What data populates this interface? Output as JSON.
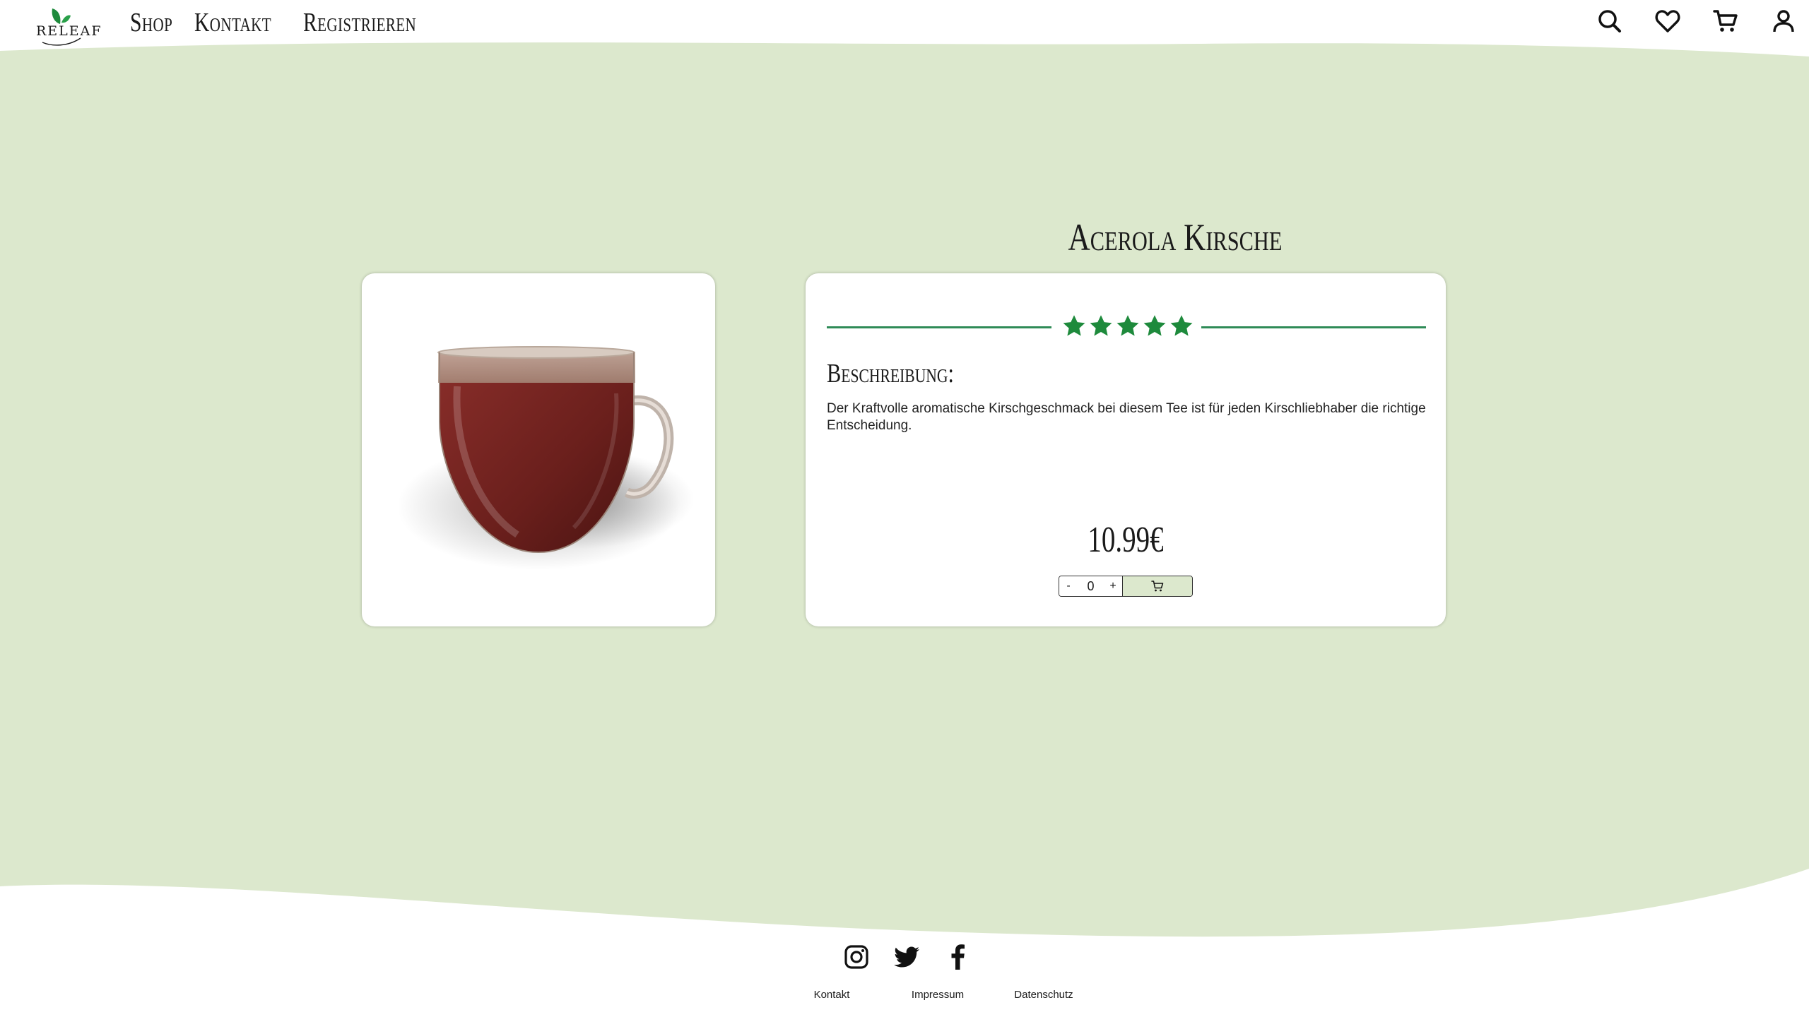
{
  "header": {
    "logo_text": "RELEAF",
    "nav": [
      "Shop",
      "Kontakt",
      "Registrieren"
    ],
    "icons": [
      "search-icon",
      "heart-icon",
      "cart-icon",
      "user-icon"
    ]
  },
  "product": {
    "title": "Acerola Kirsche",
    "rating": 5,
    "rating_max": 5,
    "description_heading": "Beschreibung:",
    "description": "Der Kraftvolle aromatische Kirschgeschmack bei diesem Tee ist für jeden Kirschliebhaber die richtige Entscheidung.",
    "price": "10.99€",
    "quantity": "0",
    "decrement_label": "-",
    "increment_label": "+",
    "image_icon": "tea-cup-image"
  },
  "footer": {
    "social": [
      "instagram-icon",
      "twitter-icon",
      "facebook-icon"
    ],
    "links": [
      "Kontakt",
      "Impressum",
      "Datenschutz"
    ]
  },
  "colors": {
    "background_green": "#dce8cd",
    "star_green": "#1e8a3c",
    "line_green": "#2e8b57",
    "card_white": "#ffffff"
  }
}
